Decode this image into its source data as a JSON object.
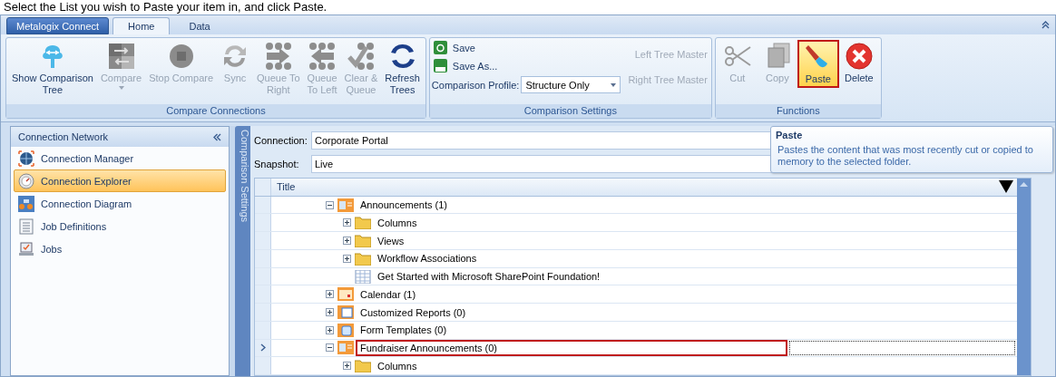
{
  "caption": "Select the List you wish to Paste your item in, and click Paste.",
  "ribbon": {
    "app_button": "Metalogix Connect",
    "tabs": [
      {
        "label": "Home",
        "selected": true
      },
      {
        "label": "Data",
        "selected": false
      }
    ],
    "compare_group": {
      "title": "Compare Connections",
      "buttons": [
        {
          "kind": "tree",
          "label": "Show Comparison\nTree",
          "disabled": false
        },
        {
          "kind": "compare",
          "label": "Compare",
          "disabled": true,
          "dropdown": true
        },
        {
          "kind": "stop",
          "label": "Stop Compare",
          "disabled": true
        },
        {
          "kind": "sync",
          "label": "Sync",
          "disabled": true
        },
        {
          "kind": "queue-right",
          "label": "Queue To\nRight",
          "disabled": true
        },
        {
          "kind": "queue-left",
          "label": "Queue\nTo Left",
          "disabled": true
        },
        {
          "kind": "clear-queue",
          "label": "Clear &\nQueue",
          "disabled": true
        },
        {
          "kind": "refresh",
          "label": "Refresh\nTrees",
          "disabled": false
        }
      ]
    },
    "settings_group": {
      "title": "Comparison Settings",
      "save": "Save",
      "save_as": "Save As...",
      "profile_label": "Comparison Profile:",
      "profile_value": "Structure Only",
      "masters": [
        {
          "label": "Left Tree Master",
          "disabled": true
        },
        {
          "label": "Right Tree Master",
          "disabled": true
        }
      ]
    },
    "functions_group": {
      "title": "Functions",
      "buttons": [
        {
          "kind": "cut",
          "label": "Cut",
          "disabled": true,
          "selected": false
        },
        {
          "kind": "copy",
          "label": "Copy",
          "disabled": true,
          "selected": false
        },
        {
          "kind": "paste",
          "label": "Paste",
          "disabled": false,
          "selected": true
        },
        {
          "kind": "delete",
          "label": "Delete",
          "disabled": false,
          "selected": false
        }
      ]
    }
  },
  "sidebar": {
    "title": "Connection Network",
    "items": [
      {
        "kind": "manager",
        "label": "Connection Manager",
        "selected": false
      },
      {
        "kind": "explorer",
        "label": "Connection Explorer",
        "selected": true
      },
      {
        "kind": "diagram",
        "label": "Connection Diagram",
        "selected": false
      },
      {
        "kind": "definitions",
        "label": "Job Definitions",
        "selected": false
      },
      {
        "kind": "jobs",
        "label": "Jobs",
        "selected": false
      }
    ]
  },
  "side_tab": "Comparison Settings",
  "connection": {
    "label": "Connection:",
    "value": "Corporate Portal"
  },
  "snapshot": {
    "label": "Snapshot:",
    "value": "Live"
  },
  "tree": {
    "column": "Title",
    "items": [
      {
        "kind": "list",
        "label": "Announcements (1)",
        "expanded": true,
        "selected": false,
        "children": [
          {
            "kind": "folder",
            "label": "Columns",
            "expanded": false,
            "selected": false
          },
          {
            "kind": "folder",
            "label": "Views",
            "expanded": false,
            "selected": false
          },
          {
            "kind": "folder",
            "label": "Workflow Associations",
            "expanded": false,
            "selected": false
          },
          {
            "kind": "page",
            "label": "Get Started with Microsoft SharePoint Foundation!",
            "selected": false
          }
        ]
      },
      {
        "kind": "calendar",
        "label": "Calendar (1)",
        "expanded": false,
        "selected": false
      },
      {
        "kind": "report",
        "label": "Customized Reports (0)",
        "expanded": false,
        "selected": false
      },
      {
        "kind": "form",
        "label": "Form Templates (0)",
        "expanded": false,
        "selected": false
      },
      {
        "kind": "list",
        "label": "Fundraiser Announcements  (0)",
        "expanded": true,
        "selected": true,
        "children": [
          {
            "kind": "folder",
            "label": "Columns",
            "expanded": false,
            "selected": false
          }
        ]
      }
    ]
  },
  "tooltip": {
    "title": "Paste",
    "text": "Pastes the content that was most recently cut or copied to memory to the selected folder."
  }
}
